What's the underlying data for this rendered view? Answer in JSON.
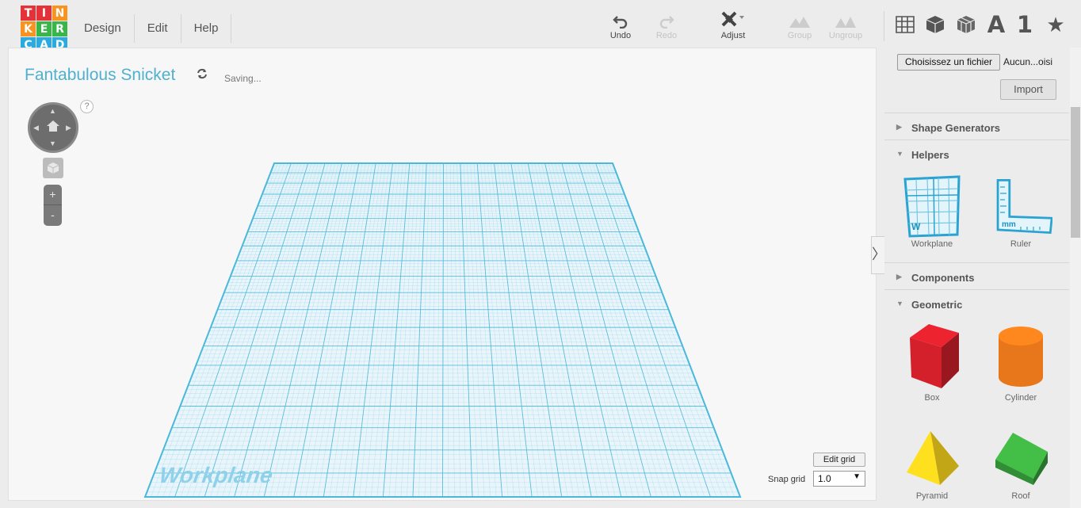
{
  "logo": {
    "letters": [
      "T",
      "I",
      "N",
      "K",
      "E",
      "R",
      "C",
      "A",
      "D"
    ],
    "colors": [
      "#e53238",
      "#e53238",
      "#f7931e",
      "#f7931e",
      "#39b54a",
      "#39b54a",
      "#29abe2",
      "#29abe2",
      "#29abe2"
    ]
  },
  "menu": [
    {
      "label": "Design"
    },
    {
      "label": "Edit"
    },
    {
      "label": "Help"
    }
  ],
  "toolbar": {
    "undo": "Undo",
    "redo": "Redo",
    "adjust": "Adjust",
    "group": "Group",
    "ungroup": "Ungroup",
    "text_tool": "A",
    "number_tool": "1"
  },
  "project": {
    "title": "Fantabulous Snicket",
    "status": "Saving..."
  },
  "view": {
    "help": "?",
    "zoom_in": "+",
    "zoom_out": "-"
  },
  "workplane": {
    "label": "Workplane",
    "grid_color": "#4ab8db"
  },
  "grid": {
    "edit_label": "Edit grid",
    "snap_label": "Snap grid",
    "snap_value": "1.0"
  },
  "panel": {
    "file_button": "Choisissez un fichier",
    "file_name": "Aucun...oisi",
    "import_button": "Import",
    "sections": [
      {
        "label": "Shape Generators",
        "expanded": false
      },
      {
        "label": "Helpers",
        "expanded": true
      },
      {
        "label": "Components",
        "expanded": false
      },
      {
        "label": "Geometric",
        "expanded": true
      }
    ],
    "helpers": [
      {
        "label": "Workplane",
        "icon_text": "W"
      },
      {
        "label": "Ruler",
        "icon_text": "mm"
      }
    ],
    "geometric": [
      {
        "label": "Box",
        "color": "#d4202b"
      },
      {
        "label": "Cylinder",
        "color": "#e8761a"
      },
      {
        "label": "Pyramid",
        "color": "#f2cf1c"
      },
      {
        "label": "Roof",
        "color": "#3aa63f"
      }
    ]
  }
}
